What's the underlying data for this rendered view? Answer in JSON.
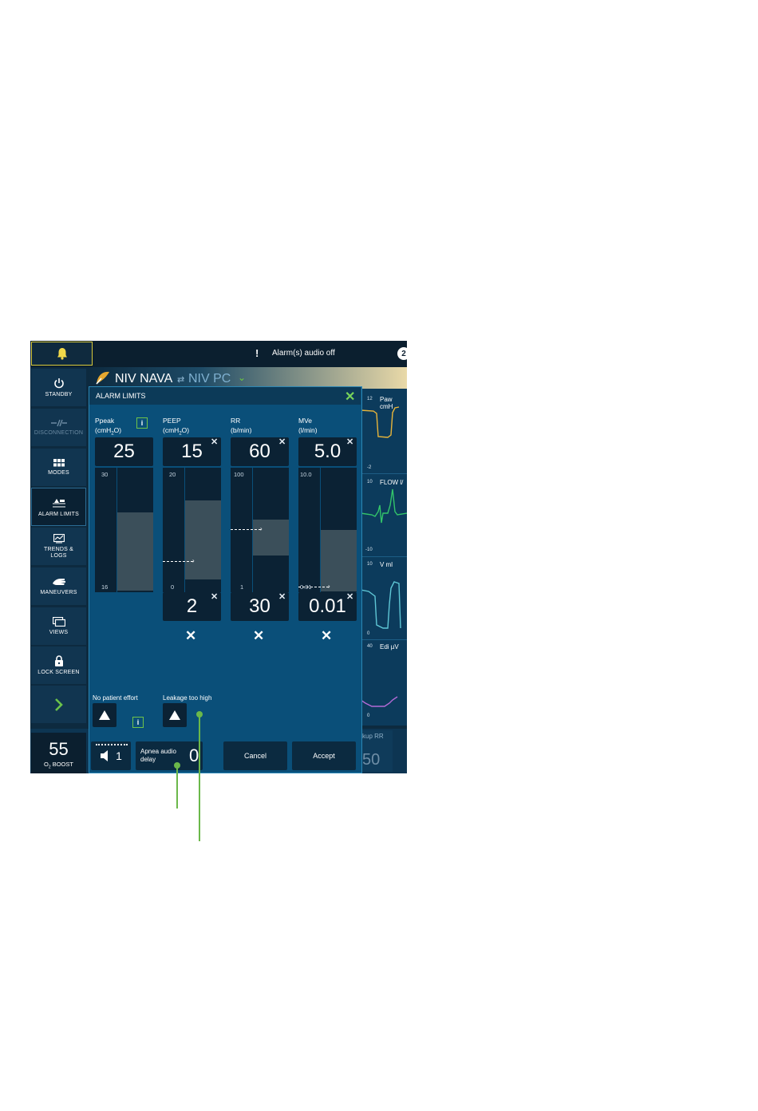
{
  "topbar": {
    "alarm_text": "Alarm(s) audio off",
    "alarm_icon": "!",
    "alarm_count": "2"
  },
  "sidebar": {
    "items": [
      {
        "label": "STANDBY",
        "icon": "power-icon"
      },
      {
        "label": "DISCONNECTION",
        "icon": "disconnect-icon"
      },
      {
        "label": "MODES",
        "icon": "grid-icon"
      },
      {
        "label": "ALARM LIMITS",
        "icon": "alarm-limits-icon"
      },
      {
        "label": "TRENDS &",
        "label2": "LOGS",
        "icon": "trends-icon"
      },
      {
        "label": "MANEUVERS",
        "icon": "hand-icon"
      },
      {
        "label": "VIEWS",
        "icon": "views-icon"
      },
      {
        "label": "LOCK SCREEN",
        "icon": "lock-icon"
      },
      {
        "label": "",
        "icon": "chevron-right-icon"
      }
    ],
    "o2_value": "55",
    "o2_label_prefix": "O",
    "o2_label_sub": "2",
    "o2_label_suffix": " BOOST"
  },
  "mode": {
    "current": "NIV NAVA",
    "swap": "⇄",
    "alternate": "NIV PC",
    "chevron": "⌄"
  },
  "waveforms": [
    {
      "label": "Paw cmH",
      "top_scale": "12",
      "bottom_scale": "-2"
    },
    {
      "label": "FLOW l/",
      "top_scale": "10",
      "bottom_scale": "-10"
    },
    {
      "label": "V ml",
      "top_scale": "10",
      "bottom_scale": "0"
    },
    {
      "label": "Edi µV",
      "top_scale": "40",
      "bottom_scale": "0"
    }
  ],
  "backup": {
    "label": "kup RR",
    "value": "50"
  },
  "dialog": {
    "title": "ALARM LIMITS",
    "close": "✕",
    "params": [
      {
        "name": "Ppeak",
        "unit": "(cmH2O)",
        "upper": "25",
        "scale_top": "30",
        "scale_bottom": "16",
        "lower": "",
        "has_upper_x": false
      },
      {
        "name": "PEEP",
        "unit": "(cmH2O)",
        "upper": "15",
        "scale_top": "20",
        "scale_bottom": "0",
        "lower": "2",
        "has_upper_x": true
      },
      {
        "name": "RR",
        "unit": "(b/min)",
        "upper": "60",
        "scale_top": "100",
        "scale_bottom": "1",
        "lower": "30",
        "has_upper_x": true
      },
      {
        "name": "MVe",
        "unit": "(l/min)",
        "upper": "5.0",
        "scale_top": "10.0",
        "scale_bottom": "0.01",
        "lower": "0.01",
        "has_upper_x": true
      }
    ],
    "no_patient_effort": "No patient effort",
    "leakage": "Leakage too high",
    "apnea_label": "Apnea audio delay",
    "apnea_value": "0",
    "volume_value": "1",
    "cancel": "Cancel",
    "accept": "Accept"
  },
  "colors": {
    "accent_green": "#6bb84a",
    "bell_yellow": "#d8c93a",
    "paw_wave": "#e8b53a",
    "flow_wave": "#33c46a",
    "volume_wave": "#5fc7d6",
    "edi_wave": "#b46ad6"
  }
}
